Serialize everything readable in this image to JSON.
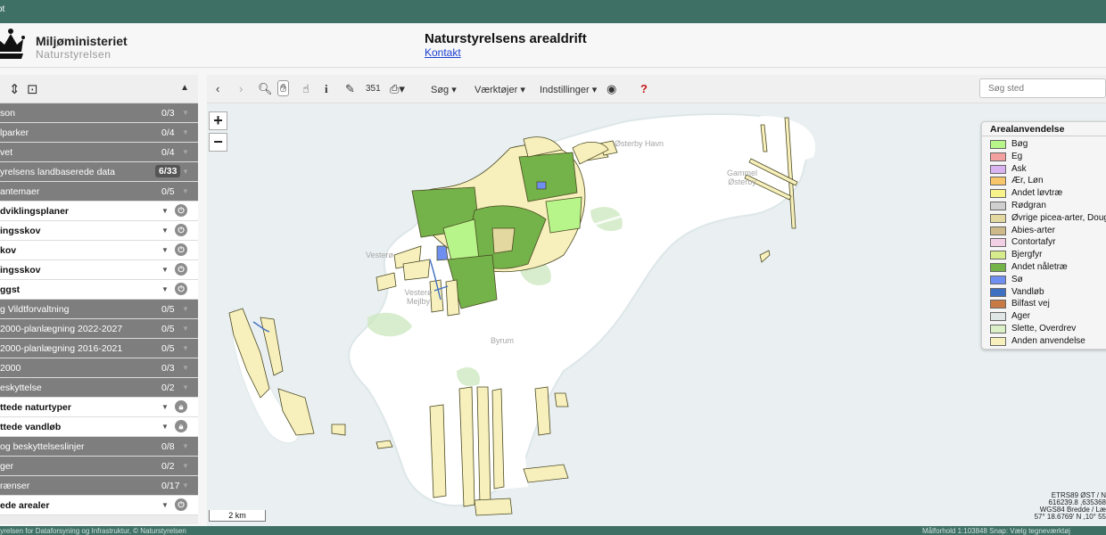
{
  "topbar": {
    "label": "ot"
  },
  "header": {
    "ministry": "Miljøministeriet",
    "agency": "Naturstyrelsen",
    "app_title": "Naturstyrelsens arealdrift",
    "contact": "Kontakt"
  },
  "sidebar": {
    "layers": [
      {
        "name": "son",
        "count": "0/3",
        "kind": "group"
      },
      {
        "name": "lparker",
        "count": "0/4",
        "kind": "group"
      },
      {
        "name": "vet",
        "count": "0/4",
        "kind": "group"
      },
      {
        "name": "yrelsens landbaserede data",
        "count": "6/33",
        "kind": "group",
        "highlight": true
      },
      {
        "name": "antemaer",
        "count": "0/5",
        "kind": "group"
      },
      {
        "name": "dviklingsplaner",
        "kind": "sub"
      },
      {
        "name": "ingsskov",
        "kind": "sub"
      },
      {
        "name": "kov",
        "kind": "sub"
      },
      {
        "name": "ingsskov",
        "kind": "sub"
      },
      {
        "name": "ggst",
        "kind": "sub"
      },
      {
        "name": "g Vildtforvaltning",
        "count": "0/5",
        "kind": "group"
      },
      {
        "name": "2000-planlægning 2022-2027",
        "count": "0/5",
        "kind": "group"
      },
      {
        "name": "2000-planlægning 2016-2021",
        "count": "0/5",
        "kind": "group"
      },
      {
        "name": "2000",
        "count": "0/3",
        "kind": "group"
      },
      {
        "name": "eskyttelse",
        "count": "0/2",
        "kind": "group"
      },
      {
        "name": "ttede naturtyper",
        "kind": "sub",
        "locked": true
      },
      {
        "name": "ttede vandløb",
        "kind": "sub",
        "locked": true
      },
      {
        "name": "og beskyttelseslinjer",
        "count": "0/8",
        "kind": "group"
      },
      {
        "name": "ger",
        "count": "0/2",
        "kind": "group"
      },
      {
        "name": "rænser",
        "count": "0/17",
        "kind": "group"
      },
      {
        "name": "ede arealer",
        "kind": "sub"
      }
    ]
  },
  "toolbar": {
    "search_menu": "Søg",
    "tools_menu": "Værktøjer",
    "settings_menu": "Indstillinger",
    "measure_label": "351",
    "search_placeholder": "Søg sted"
  },
  "map": {
    "zoom_in": "+",
    "zoom_out": "−",
    "places": [
      {
        "name": "Østerby Havn"
      },
      {
        "name": "Gammel Østerby"
      },
      {
        "name": "Vesterø"
      },
      {
        "name": "Vesterø Mejlby"
      },
      {
        "name": "Byrum"
      }
    ],
    "scale_label": "2 km",
    "coords": {
      "line1": "ETRS89 ØST / N",
      "line2": "616239.8 ,635368",
      "line3": "WGS84 Bredde / Læ",
      "line4": "57° 18.6769' N ,10° 55"
    }
  },
  "legend": {
    "title": "Arealanvendelse",
    "items": [
      {
        "label": "Bøg",
        "color": "#b7f58a"
      },
      {
        "label": "Eg",
        "color": "#f2a0a0"
      },
      {
        "label": "Ask",
        "color": "#d9b3ef"
      },
      {
        "label": "Ær, Løn",
        "color": "#f7c66a"
      },
      {
        "label": "Andet løvtræ",
        "color": "#f7f28a"
      },
      {
        "label": "Rødgran",
        "color": "#cfcfcf"
      },
      {
        "label": "Øvrige picea-arter, Dougl",
        "color": "#e3d9a0"
      },
      {
        "label": "Abies-arter",
        "color": "#cdb98a"
      },
      {
        "label": "Contortafyr",
        "color": "#f3cfe6"
      },
      {
        "label": "Bjergfyr",
        "color": "#d7ec8a"
      },
      {
        "label": "Andet nåletræ",
        "color": "#74b24a"
      },
      {
        "label": "Sø",
        "color": "#6f8ff0"
      },
      {
        "label": "Vandløb",
        "color": "#3f6fc0"
      },
      {
        "label": "Bilfast vej",
        "color": "#c87a45"
      },
      {
        "label": "Ager",
        "color": "#e0e5e5"
      },
      {
        "label": "Slette, Overdrev",
        "color": "#dcf0c8"
      },
      {
        "label": "Anden anvendelse",
        "color": "#f7efbc"
      }
    ]
  },
  "footer": {
    "left": "tyrelsen for Dataforsyning og Infrastruktur, © Naturstyrelsen",
    "right": "Målforhold 1:103848    Snap: Vælg tegneværktøj"
  }
}
